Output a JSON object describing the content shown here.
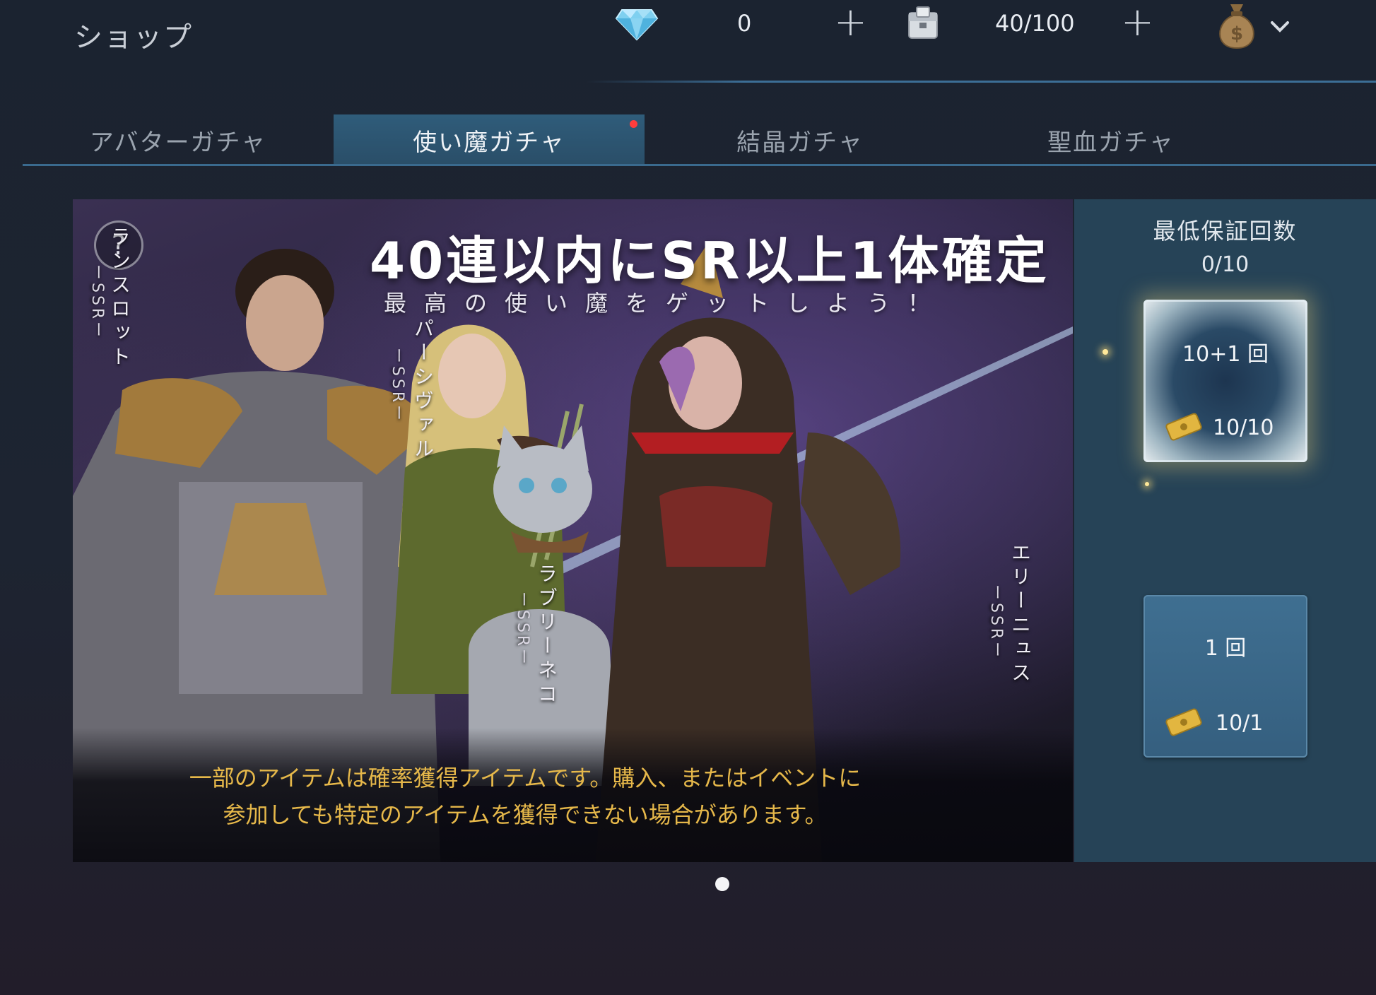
{
  "header": {
    "title": "ショップ",
    "gems": "0",
    "stock": "40/100",
    "plus_label": "+"
  },
  "tabs": [
    {
      "label": "アバターガチャ",
      "active": false
    },
    {
      "label": "使い魔ガチャ",
      "active": true,
      "has_notification": true
    },
    {
      "label": "結晶ガチャ",
      "active": false
    },
    {
      "label": "聖血ガチャ",
      "active": false
    }
  ],
  "banner": {
    "headline": "40連以内にSR以上1体確定",
    "subline": "最高の使い魔をゲットしよう！",
    "help": "?",
    "characters": [
      {
        "name": "ランスロット",
        "rank": "ーSSRー"
      },
      {
        "name": "パーシヴァル",
        "rank": "ーSSRー"
      },
      {
        "name": "ラブリーネコ",
        "rank": "ーSSRー"
      },
      {
        "name": "エリーニュス",
        "rank": "ーSSRー"
      }
    ],
    "notice_line1": "一部のアイテムは確率獲得アイテムです。購入、またはイベントに",
    "notice_line2": "参加しても特定のアイテムを獲得できない場合があります。"
  },
  "side": {
    "title": "最低保証回数",
    "count": "0/10",
    "pull10": {
      "label": "10+1 回",
      "cost": "10/10"
    },
    "pull1": {
      "label": "1 回",
      "cost": "10/1"
    }
  },
  "colors": {
    "accent": "#2f5c7a",
    "notice": "#e6b84a",
    "notification": "#ff3d3d"
  },
  "pager": {
    "pages": 1,
    "current": 1
  }
}
